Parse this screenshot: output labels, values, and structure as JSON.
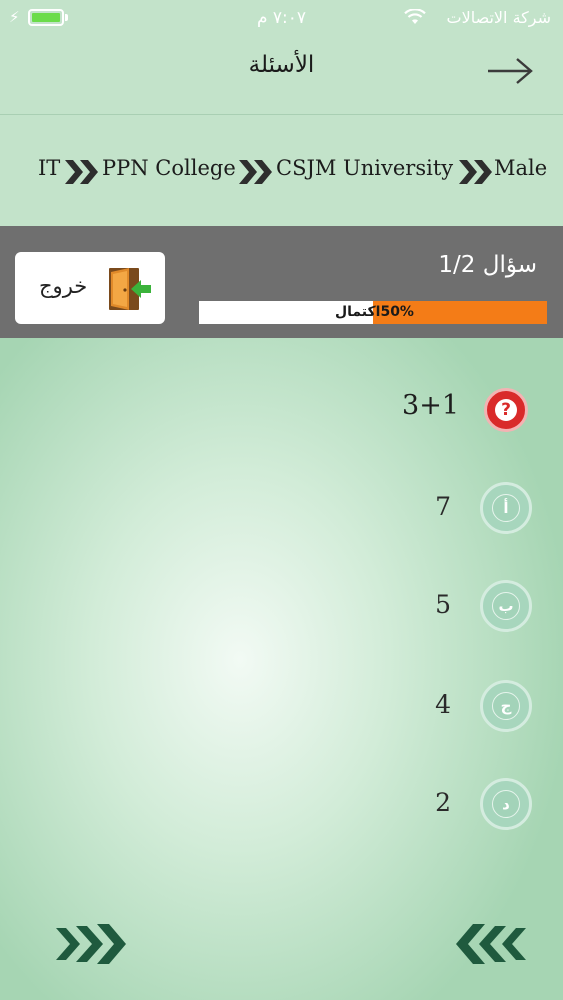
{
  "status_bar": {
    "carrier": "شركة الاتصالات",
    "time": "٧:٠٧ م",
    "battery_level": 1.0
  },
  "nav": {
    "title": "الأسئلة",
    "back_icon": "arrow-right-icon"
  },
  "breadcrumb": {
    "items": [
      "IT",
      "PPN College",
      "CSJM University",
      "Male"
    ],
    "separator_icon": "double-chevron-right-icon"
  },
  "progress_panel": {
    "exit_label": "خروج",
    "exit_icon": "exit-door-icon",
    "question_count": "سؤال 1/2",
    "progress_word": "اكتمال",
    "progress_value": "50%",
    "progress_fraction": 0.5,
    "progress_color": "#f47c17"
  },
  "question": {
    "icon": "question-mark-icon",
    "text": "3+1",
    "options": [
      {
        "letter": "أ",
        "text": "7"
      },
      {
        "letter": "ب",
        "text": "5"
      },
      {
        "letter": "ج",
        "text": "4"
      },
      {
        "letter": "د",
        "text": "2"
      }
    ]
  },
  "footer": {
    "next_icon": "triple-chevron-right-icon",
    "prev_icon": "triple-chevron-left-icon"
  }
}
